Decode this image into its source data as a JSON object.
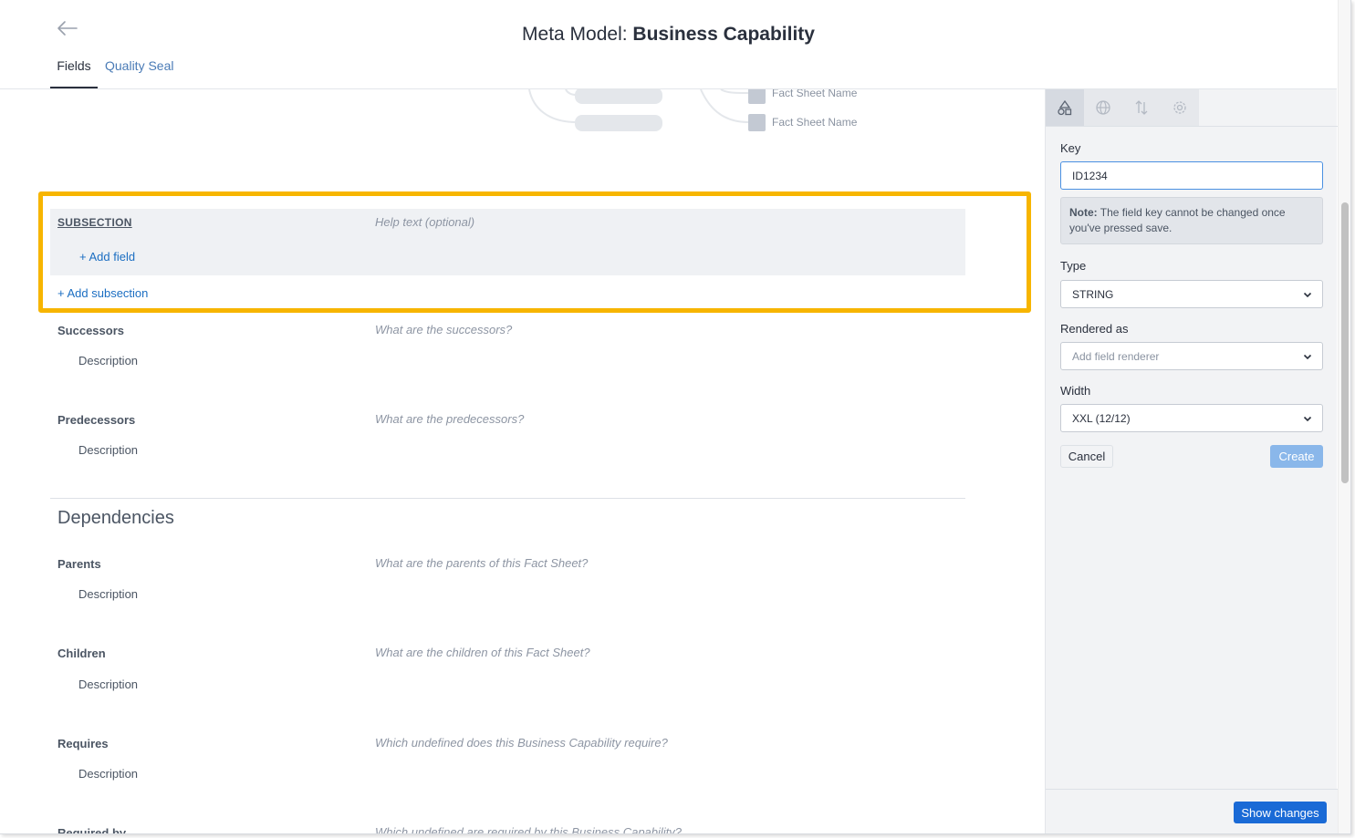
{
  "header": {
    "title_prefix": "Meta Model: ",
    "title_bold": "Business Capability",
    "tabs": [
      {
        "label": "Fields"
      },
      {
        "label": "Quality Seal"
      }
    ]
  },
  "diagram": {
    "fact_sheet_labels": [
      "Fact Sheet Name",
      "Fact Sheet Name"
    ]
  },
  "subsection": {
    "label": "SUBSECTION",
    "help_placeholder": "Help text (optional)",
    "add_field": "+ Add field",
    "add_subsection": "+ Add subsection"
  },
  "fields_top": [
    {
      "name": "Successors",
      "desc": "Description",
      "help": "What are the successors?"
    },
    {
      "name": "Predecessors",
      "desc": "Description",
      "help": "What are the predecessors?"
    }
  ],
  "dependencies": {
    "title": "Dependencies",
    "fields": [
      {
        "name": "Parents",
        "desc": "Description",
        "help": "What are the parents of this Fact Sheet?"
      },
      {
        "name": "Children",
        "desc": "Description",
        "help": "What are the children of this Fact Sheet?"
      },
      {
        "name": "Requires",
        "desc": "Description",
        "help": "Which undefined does this Business Capability require?"
      },
      {
        "name": "Required by",
        "desc": "",
        "help": "Which undefined are required by this Business Capability?"
      }
    ]
  },
  "side": {
    "key_label": "Key",
    "key_value": "ID1234",
    "note_bold": "Note:",
    "note_text": " The field key cannot be changed once you've pressed save.",
    "type_label": "Type",
    "type_value": "STRING",
    "rendered_label": "Rendered as",
    "rendered_placeholder": "Add field renderer",
    "width_label": "Width",
    "width_value": "XXL (12/12)",
    "cancel": "Cancel",
    "create": "Create",
    "show_changes": "Show changes",
    "tab_icons": [
      "shapes-icon",
      "globe-icon",
      "sort-icon",
      "gear-icon"
    ]
  },
  "colors": {
    "highlight": "#f7b500",
    "link": "#1b6ec2",
    "primary_button": "#1a6ad6",
    "disabled_button": "#8ab7ea"
  }
}
